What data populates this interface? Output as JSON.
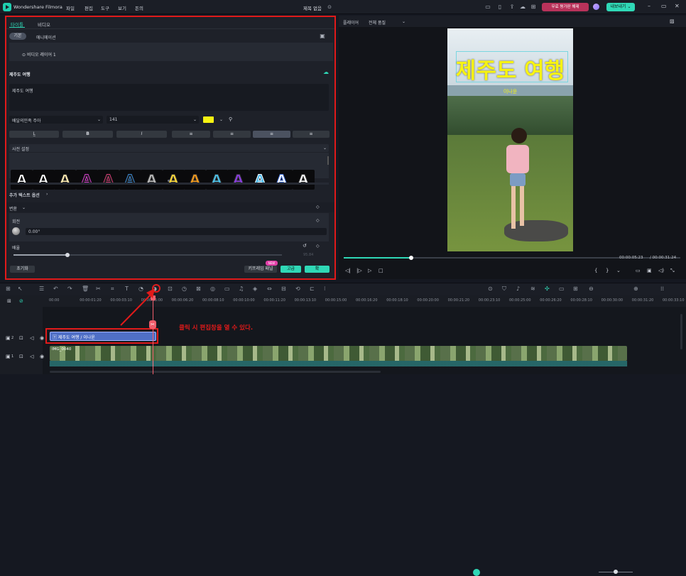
{
  "app": {
    "title": "Wondershare Filmora",
    "project": "제목 없음"
  },
  "menu": [
    "파일",
    "편집",
    "도구",
    "보기",
    "돈의"
  ],
  "promo_label": "무료 평가판 해제",
  "export_label": "내보내기 ⌄",
  "left_panel": {
    "tabs": [
      "타이틀",
      "비디오"
    ],
    "subtabs": [
      "기본",
      "애니메이션"
    ],
    "layer_label": "비디오 레이어 1",
    "section_title": "제주도 여행",
    "text_value": "제주도 여행",
    "font_name": "배달의민족 주아",
    "font_size": "141",
    "text_color": "#f7f312",
    "format_buttons": [
      "L̲",
      "B",
      "I",
      "≡",
      "≡",
      "≡",
      "≡"
    ],
    "preset_label": "사전 설정",
    "presets": [
      {
        "fill": "#ffffff",
        "stroke": "#000000"
      },
      {
        "fill": "#ffffff",
        "stroke": "#000000"
      },
      {
        "fill": "#ffe9b0",
        "stroke": "#222222"
      },
      {
        "fill": "#1a1a1a",
        "stroke": "#d23cc9"
      },
      {
        "fill": "#1a1a1a",
        "stroke": "#d23c74"
      },
      {
        "fill": "#1a1a1a",
        "stroke": "#3c8ad2"
      },
      {
        "fill": "#bbbbbb",
        "stroke": "#333333"
      },
      {
        "fill": "#ffd93a",
        "stroke": "#333333"
      },
      {
        "fill": "#f59a1b",
        "stroke": "#333333"
      },
      {
        "fill": "#4cc3ea",
        "stroke": "#333333"
      },
      {
        "fill": "#8a3de0",
        "stroke": "#333333"
      },
      {
        "fill": "#4bb8e8",
        "stroke": "#ffffff"
      },
      {
        "fill": "#ffffff",
        "stroke": "#3c6ad2"
      },
      {
        "fill": "#ffffff",
        "stroke": "#333333"
      }
    ],
    "extra_text_label": "추가 텍스트 옵션",
    "transform_label": "변환",
    "rotation_label": "회전",
    "rotation_value": "0.00°",
    "scale_label": "배율",
    "scale_value": "95.84",
    "scale_fraction": 0.2,
    "reset_label": "초기화",
    "keyframe_label": "키프레임 패널",
    "new_badge": "NEW",
    "advanced_label": "고급",
    "ok_label": "확"
  },
  "preview": {
    "player_label": "플레이어",
    "quality_label": "전체 품질",
    "title_text": "제주도 여행",
    "subtitle_text": "이나윤",
    "time_current": "00:00:05:23",
    "time_total": "/ 00:00:31:24",
    "progress_fraction": 0.2
  },
  "timeline": {
    "ticks": [
      "00:00",
      "00:00:01:20",
      "00:00:03:10",
      "00:00:05:00",
      "00:00:06:20",
      "00:00:08:10",
      "00:00:10:00",
      "00:00:11:20",
      "00:00:13:10",
      "00:00:15:00",
      "00:00:16:20",
      "00:00:18:10",
      "00:00:20:00",
      "00:00:21:20",
      "00:00:23:10",
      "00:00:25:00",
      "00:00:26:20",
      "00:00:28:10",
      "00:00:30:00",
      "00:00:31:20",
      "00:00:33:10"
    ],
    "title_clip": "제주도 여행 / 이나윤",
    "video_clip": "IMG_0040",
    "annotation": "클릭 시 편집창을 열 수 있다.",
    "track_labels": [
      "2",
      "1"
    ]
  }
}
